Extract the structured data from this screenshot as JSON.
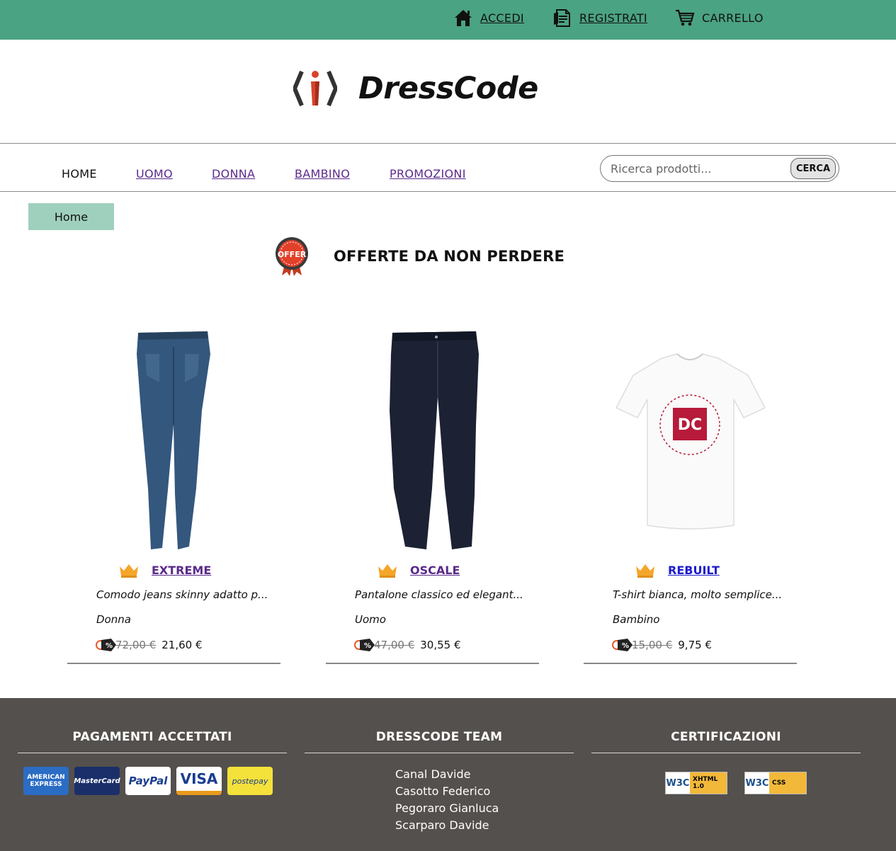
{
  "topbar": {
    "login_label": "ACCEDI",
    "register_label": "REGISTRATI",
    "cart_label": "CARRELLO"
  },
  "header": {
    "brand_name": "DressCode"
  },
  "nav": {
    "items": [
      {
        "label": "HOME",
        "active": true
      },
      {
        "label": "UOMO",
        "active": false
      },
      {
        "label": "DONNA",
        "active": false
      },
      {
        "label": "BAMBINO",
        "active": false
      },
      {
        "label": "PROMOZIONI",
        "active": false
      }
    ],
    "search_placeholder": "Ricerca prodotti...",
    "search_button": "CERCA"
  },
  "breadcrumb": {
    "current": "Home"
  },
  "offers": {
    "badge_text": "OFFER",
    "title": "OFFERTE DA NON PERDERE",
    "products": [
      {
        "brand": "EXTREME",
        "description": "Comodo jeans skinny adatto p...",
        "category": "Donna",
        "old_price": "72,00 €",
        "new_price": "21,60 €",
        "image": "skinny-jeans",
        "color": "#34577d"
      },
      {
        "brand": "OSCALE",
        "description": "Pantalone classico ed elegant...",
        "category": "Uomo",
        "old_price": "47,00 €",
        "new_price": "30,55 €",
        "image": "dark-trousers",
        "color": "#1c2233"
      },
      {
        "brand": "REBUILT",
        "description": "T-shirt bianca, molto semplice...",
        "category": "Bambino",
        "old_price": "15,00 €",
        "new_price": "9,75 €",
        "image": "white-tshirt",
        "color": "#b71a3a"
      }
    ]
  },
  "footer": {
    "payments_title": "PAGAMENTI ACCETTATI",
    "payment_methods": [
      "AMERICAN EXPRESS",
      "MasterCard",
      "PayPal",
      "VISA",
      "postepay"
    ],
    "team_title": "DRESSCODE TEAM",
    "team": [
      "Canal Davide",
      "Casotto Federico",
      "Pegoraro Gianluca",
      "Scarparo Davide"
    ],
    "certs_title": "CERTIFICAZIONI",
    "certs": [
      {
        "mark": "W3C",
        "label": "XHTML 1.0"
      },
      {
        "mark": "W3C",
        "label": "CSS"
      }
    ]
  },
  "colors": {
    "topbar": "#4aa383",
    "breadcrumb": "#9fd0bd",
    "footer": "#54504d",
    "visited_link": "#5a2a8a",
    "link": "#1c1ccc"
  }
}
